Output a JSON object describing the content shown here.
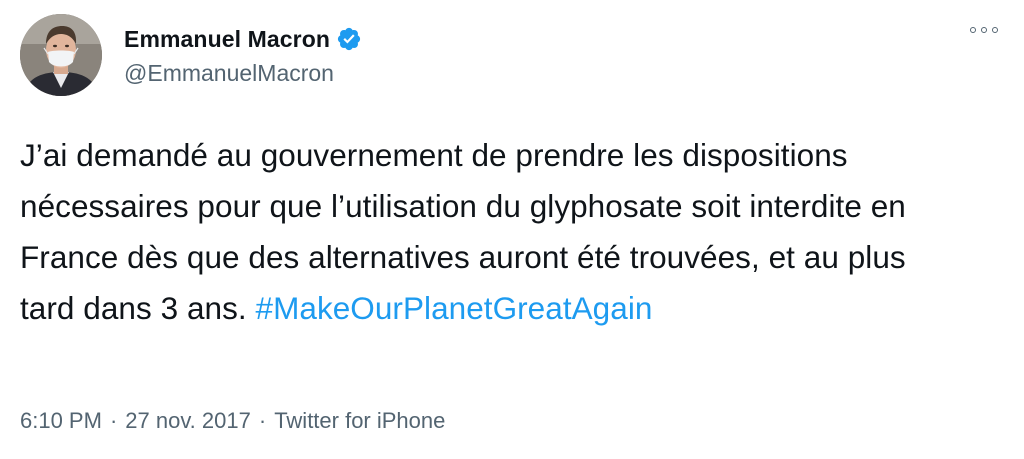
{
  "author": {
    "display_name": "Emmanuel Macron",
    "handle": "@EmmanuelMacron",
    "verified": true,
    "avatar_icon": "profile-photo"
  },
  "tweet": {
    "text": "J’ai demandé au gouvernement de prendre les dispositions nécessaires pour que l’utilisation du glyphosate soit interdite en France dès que des alternatives auront été trouvées, et au plus tard dans 3 ans.",
    "hashtag": "#MakeOurPlanetGreatAgain"
  },
  "meta": {
    "time": "6:10 PM",
    "date": "27 nov. 2017",
    "separator": "·",
    "source": "Twitter for iPhone"
  },
  "icons": {
    "verified": "verified-badge-icon",
    "more": "more-options-icon"
  },
  "colors": {
    "link": "#1d9bf0",
    "secondary": "#536471",
    "text": "#0f1419",
    "verified": "#1d9bf0"
  }
}
